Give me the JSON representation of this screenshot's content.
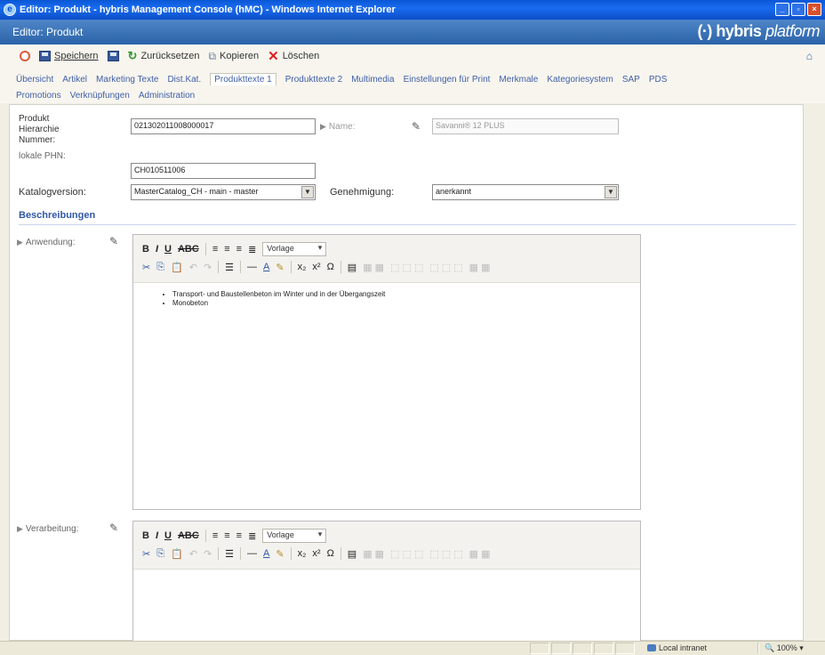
{
  "window": {
    "title": "Editor: Produkt - hybris Management Console (hMC) - Windows Internet Explorer"
  },
  "editor": {
    "title": "Editor: Produkt",
    "brand_logo": "hybris platform"
  },
  "toolbar": {
    "save": "Speichern",
    "reset": "Zurücksetzen",
    "copy": "Kopieren",
    "delete": "Löschen"
  },
  "tabs": {
    "row1": [
      {
        "label": "Übersicht"
      },
      {
        "label": "Artikel"
      },
      {
        "label": "Marketing Texte"
      },
      {
        "label": "Dist.Kat."
      },
      {
        "label": "Produkttexte 1"
      },
      {
        "label": "Produkttexte 2"
      },
      {
        "label": "Multimedia"
      },
      {
        "label": "Einstellungen für Print"
      },
      {
        "label": "Merkmale"
      },
      {
        "label": "Kategoriesystem"
      },
      {
        "label": "SAP"
      },
      {
        "label": "PDS"
      }
    ],
    "row2": [
      {
        "label": "Promotions"
      },
      {
        "label": "Verknüpfungen"
      },
      {
        "label": "Administration"
      }
    ],
    "active": "Produkttexte 1"
  },
  "form": {
    "hierarchy_label_1": "Produkt",
    "hierarchy_label_2": "Hierarchie",
    "hierarchy_label_3": "Nummer:",
    "hierarchy_value": "021302011008000017",
    "name_label": "Name:",
    "name_value": "Savanni® 12 PLUS",
    "local_phn_label": "lokale PHN:",
    "local_phn_value": "CH010511006",
    "catalog_label": "Katalogversion:",
    "catalog_value": "MasterCatalog_CH - main - master",
    "approval_label": "Genehmigung:",
    "approval_value": "anerkannt"
  },
  "descriptions": {
    "section_title": "Beschreibungen",
    "application_label": "Anwendung:",
    "application_items": [
      "Transport- und Baustellenbeton im Winter und in der Übergangszeit",
      "Monobeton"
    ],
    "processing_label": "Verarbeitung:",
    "style_dropdown": "Vorlage"
  },
  "statusbar": {
    "zone": "Local intranet",
    "zoom": "100%"
  }
}
